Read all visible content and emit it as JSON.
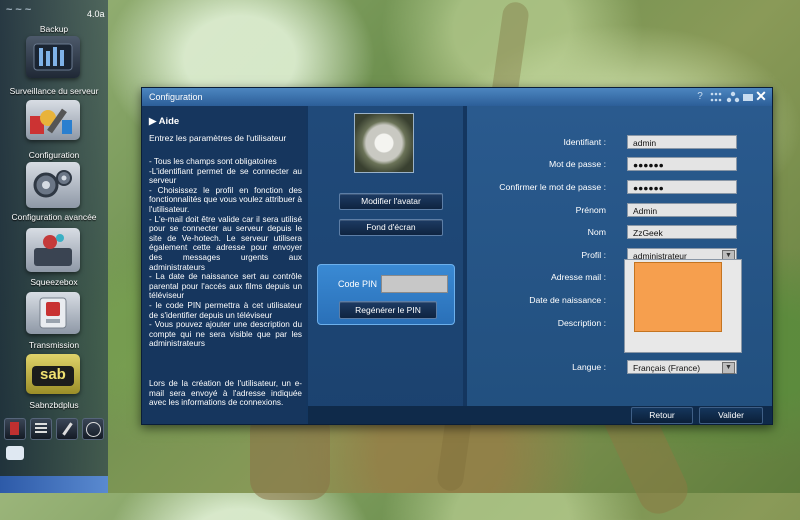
{
  "sidebar": {
    "version": "4.0a",
    "items": [
      {
        "label": "Backup"
      },
      {
        "label": "Surveillance du serveur"
      },
      {
        "label": "Configuration"
      },
      {
        "label": "Configuration avancée"
      },
      {
        "label": "Squeezebox"
      },
      {
        "label": "Transmission"
      },
      {
        "label": "Sabnzbdplus"
      }
    ],
    "sab_text": "sab"
  },
  "window": {
    "title": "Configuration",
    "close": "✕",
    "help_icon": "?"
  },
  "help": {
    "heading": "▶ Aide",
    "intro": "Entrez les paramètres de l'utilisateur",
    "body": [
      "- Tous les champs sont obligatoires",
      "-L'identifiant permet de se connecter au serveur",
      "- Choisissez le profil en fonction des fonctionnalités que vous voulez attribuer à l'utilisateur.",
      "- L'e-mail doit être valide car il sera utilisé pour se connecter au serveur depuis le site de Ve-hotech. Le serveur utilisera également cette adresse pour envoyer des messages urgents aux administrateurs",
      "- La date de naissance sert au contrôle parental pour l'accés aux films depuis un téléviseur",
      "- le code PIN permettra à cet utilisateur de s'identifier depuis un téléviseur",
      "- Vous pouvez ajouter une description du compte qui ne sera visible que par les administrateurs"
    ],
    "footer": "Lors de la création de l'utilisateur, un e-mail sera envoyé à l'adresse indiquée avec les informations de connexions."
  },
  "middle": {
    "avatar_button": "Modifier l'avatar",
    "wallpaper_button": "Fond d'écran",
    "pin_label": "Code PIN",
    "pin_value": "",
    "regen_button": "Regénérer le PIN"
  },
  "form": {
    "identifiant_label": "Identifiant :",
    "identifiant_value": "admin",
    "password_label": "Mot de passe :",
    "password_value": "●●●●●●",
    "confirm_label": "Confirmer le mot de passe :",
    "confirm_value": "●●●●●●",
    "prenom_label": "Prénom",
    "prenom_value": "Admin",
    "nom_label": "Nom",
    "nom_value": "ZzGeek",
    "profil_label": "Profil :",
    "profil_value": "administrateur",
    "email_label": "Adresse mail :",
    "birth_label": "Date de naissance :",
    "desc_label": "Description :",
    "langue_label": "Langue :",
    "langue_value": "Français (France)"
  },
  "footer": {
    "back_button": "Retour",
    "validate_button": "Valider"
  },
  "colors": {
    "window_bg": "#14365f",
    "titlebar": "#3a74b0",
    "overlay": "#f69f4e",
    "pin_box": "#3a8ad4"
  }
}
